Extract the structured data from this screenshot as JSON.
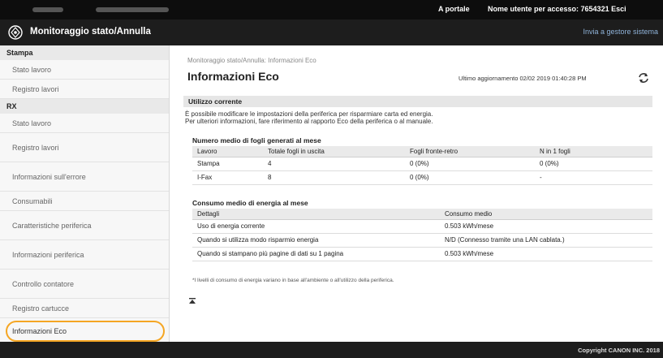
{
  "topbar": {
    "portal_link": "A portale",
    "user_label": "Nome utente per accesso:  7654321  Esci"
  },
  "header": {
    "title": "Monitoraggio stato/Annulla",
    "to_system_link": "Invia a gestore sistema"
  },
  "sidebar": {
    "groups": [
      {
        "label": "Stampa",
        "items": [
          {
            "label": "Stato lavoro"
          },
          {
            "label": "Registro lavori"
          }
        ]
      },
      {
        "label": "RX",
        "items": [
          {
            "label": "Stato lavoro"
          },
          {
            "label": "Registro lavori"
          },
          {
            "label": "Informazioni sull'errore"
          },
          {
            "label": "Consumabili"
          },
          {
            "label": "Caratteristiche periferica"
          },
          {
            "label": "Informazioni periferica"
          },
          {
            "label": "Controllo contatore"
          },
          {
            "label": "Registro cartucce"
          },
          {
            "label": "Informazioni Eco"
          }
        ]
      }
    ]
  },
  "main": {
    "breadcrumb": "Monitoraggio stato/Annulla: Informazioni Eco",
    "page_title": "Informazioni Eco",
    "last_update": "Ultimo aggiornamento 02/02 2019 01:40:28 PM",
    "section_title": "Utilizzo corrente",
    "description_line1": "È possibile modificare le impostazioni della periferica per risparmiare carta ed energia.",
    "description_line2": "Per ulteriori informazioni, fare riferimento al rapporto Eco della periferica o al manuale.",
    "paper_table": {
      "title": "Numero medio di fogli generati al mese",
      "headers": [
        "Lavoro",
        "Totale fogli in uscita",
        "Fogli fronte-retro",
        "N in 1 fogli"
      ],
      "rows": [
        [
          "Stampa",
          "4",
          "0 (0%)",
          "0 (0%)"
        ],
        [
          "I-Fax",
          "8",
          "0 (0%)",
          "-"
        ]
      ]
    },
    "energy_table": {
      "title": "Consumo medio di energia al mese",
      "headers": [
        "Dettagli",
        "Consumo medio"
      ],
      "rows": [
        [
          "Uso di energia corrente",
          "0.503 kWh/mese"
        ],
        [
          "Quando si utilizza modo risparmio energia",
          "N/D (Connesso tramite una LAN cablata.)"
        ],
        [
          "Quando si stampano più pagine di dati su 1 pagina",
          "0.503 kWh/mese"
        ]
      ]
    },
    "note": "*I livelli di consumo di energia variano in base all'ambiente o all'utilizzo della periferica."
  },
  "footer": {
    "copyright": "Copyright CANON INC. 2018"
  }
}
